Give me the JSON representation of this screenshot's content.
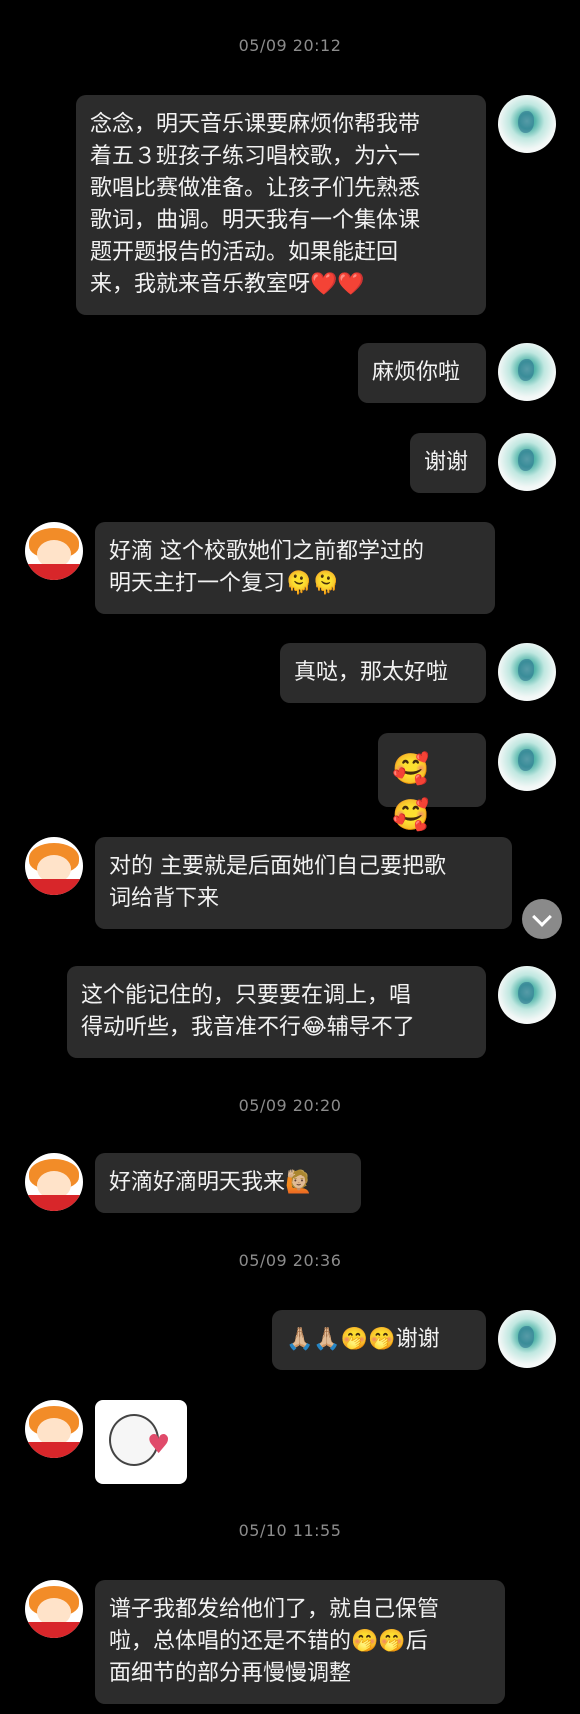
{
  "timestamps": [
    "05/09 20:12",
    "05/09 20:20",
    "05/09 20:36",
    "05/10 11:55"
  ],
  "messages": [
    {
      "sender": "me",
      "lines": [
        "念念，明天音乐课要麻烦你帮我带",
        "着五３班孩子练习唱校歌，为六一",
        "歌唱比赛做准备。让孩子们先熟悉",
        "歌词，曲调。明天我有一个集体课",
        "题开题报告的活动。如果能赶回",
        "来，我就来音乐教室呀❤️❤️"
      ]
    },
    {
      "sender": "me",
      "lines": [
        "麻烦你啦"
      ]
    },
    {
      "sender": "me",
      "lines": [
        "谢谢"
      ]
    },
    {
      "sender": "other",
      "lines": [
        "好滴 这个校歌她们之前都学过的",
        "明天主打一个复习🫠🫠"
      ]
    },
    {
      "sender": "me",
      "lines": [
        "真哒，那太好啦"
      ]
    },
    {
      "sender": "me",
      "lines": [
        "🥰🥰"
      ]
    },
    {
      "sender": "other",
      "lines": [
        "对的 主要就是后面她们自己要把歌",
        "词给背下来"
      ]
    },
    {
      "sender": "me",
      "lines": [
        "这个能记住的，只要要在调上，唱",
        "得动听些，我音准不行😂辅导不了"
      ]
    },
    {
      "sender": "other",
      "lines": [
        "好滴好滴明天我来🙋🏼"
      ]
    },
    {
      "sender": "me",
      "lines": [
        "🙏🏼🙏🏼🤭🤭谢谢"
      ]
    },
    {
      "sender": "other",
      "lines": [
        "谱子我都发给他们了，就自己保管",
        "啦，总体唱的还是不错的🤭🤭后",
        "面细节的部分再慢慢调整"
      ]
    }
  ],
  "sticker": {
    "icon": "hug-heart-sticker"
  },
  "scroll_button": {
    "icon": "chevron-down-icon"
  }
}
